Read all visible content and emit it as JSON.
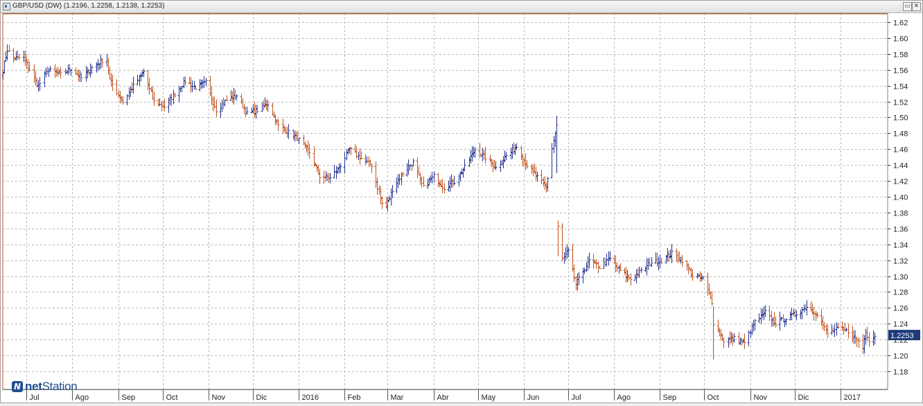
{
  "window": {
    "title": "GBP/USD (DW) (1.2196, 1.2258, 1.2138, 1.2253)",
    "minimize_glyph": "▭",
    "close_glyph": "✕"
  },
  "logo": {
    "prefix": "net",
    "suffix": "Station"
  },
  "chart_data": {
    "type": "ohlc",
    "title": "GBP/USD (DW) (1.2196, 1.2258, 1.2138, 1.2253)",
    "ylim": [
      1.16,
      1.63
    ],
    "y_ticks": [
      "1.18",
      "1.20",
      "1.22",
      "1.24",
      "1.26",
      "1.28",
      "1.30",
      "1.32",
      "1.34",
      "1.36",
      "1.38",
      "1.40",
      "1.42",
      "1.44",
      "1.46",
      "1.48",
      "1.50",
      "1.52",
      "1.54",
      "1.56",
      "1.58",
      "1.60",
      "1.62"
    ],
    "x_range": [
      "2015-06-15",
      "2017-01-31"
    ],
    "x_ticks": [
      {
        "label": "Jul",
        "date": "2015-07-01"
      },
      {
        "label": "Ago",
        "date": "2015-08-01"
      },
      {
        "label": "Sep",
        "date": "2015-09-01"
      },
      {
        "label": "Oct",
        "date": "2015-10-01"
      },
      {
        "label": "Nov",
        "date": "2015-11-01"
      },
      {
        "label": "Dic",
        "date": "2015-12-01"
      },
      {
        "label": "2016",
        "date": "2016-01-01"
      },
      {
        "label": "Feb",
        "date": "2016-02-01"
      },
      {
        "label": "Mar",
        "date": "2016-03-01"
      },
      {
        "label": "Abr",
        "date": "2016-04-01"
      },
      {
        "label": "May",
        "date": "2016-05-01"
      },
      {
        "label": "Jun",
        "date": "2016-06-01"
      },
      {
        "label": "Jul",
        "date": "2016-07-01"
      },
      {
        "label": "Ago",
        "date": "2016-08-01"
      },
      {
        "label": "Sep",
        "date": "2016-09-01"
      },
      {
        "label": "Oct",
        "date": "2016-10-01"
      },
      {
        "label": "Nov",
        "date": "2016-11-01"
      },
      {
        "label": "Dic",
        "date": "2016-12-01"
      },
      {
        "label": "2017",
        "date": "2017-01-01"
      }
    ],
    "current_price": "1.2253",
    "grid": true,
    "colors": {
      "up": "#1f2f8f",
      "down": "#c0501c",
      "grid": "#b8b8b8",
      "price_tag": "#1e3a78"
    },
    "close_anchors": [
      [
        "2015-06-15",
        1.56
      ],
      [
        "2015-06-18",
        1.585
      ],
      [
        "2015-06-22",
        1.575
      ],
      [
        "2015-06-29",
        1.575
      ],
      [
        "2015-07-06",
        1.55
      ],
      [
        "2015-07-09",
        1.54
      ],
      [
        "2015-07-15",
        1.56
      ],
      [
        "2015-07-24",
        1.555
      ],
      [
        "2015-07-31",
        1.562
      ],
      [
        "2015-08-07",
        1.55
      ],
      [
        "2015-08-14",
        1.563
      ],
      [
        "2015-08-21",
        1.572
      ],
      [
        "2015-08-24",
        1.573
      ],
      [
        "2015-08-26",
        1.548
      ],
      [
        "2015-09-04",
        1.52
      ],
      [
        "2015-09-11",
        1.54
      ],
      [
        "2015-09-18",
        1.558
      ],
      [
        "2015-09-25",
        1.52
      ],
      [
        "2015-10-02",
        1.514
      ],
      [
        "2015-10-09",
        1.53
      ],
      [
        "2015-10-16",
        1.546
      ],
      [
        "2015-10-23",
        1.538
      ],
      [
        "2015-10-30",
        1.544
      ],
      [
        "2015-11-06",
        1.51
      ],
      [
        "2015-11-13",
        1.522
      ],
      [
        "2015-11-20",
        1.528
      ],
      [
        "2015-11-27",
        1.505
      ],
      [
        "2015-12-04",
        1.51
      ],
      [
        "2015-12-11",
        1.518
      ],
      [
        "2015-12-18",
        1.49
      ],
      [
        "2015-12-31",
        1.474
      ],
      [
        "2016-01-08",
        1.456
      ],
      [
        "2016-01-15",
        1.426
      ],
      [
        "2016-01-22",
        1.424
      ],
      [
        "2016-01-29",
        1.44
      ],
      [
        "2016-02-04",
        1.46
      ],
      [
        "2016-02-12",
        1.449
      ],
      [
        "2016-02-19",
        1.44
      ],
      [
        "2016-02-26",
        1.392
      ],
      [
        "2016-02-29",
        1.388
      ],
      [
        "2016-03-04",
        1.41
      ],
      [
        "2016-03-11",
        1.43
      ],
      [
        "2016-03-18",
        1.444
      ],
      [
        "2016-03-25",
        1.412
      ],
      [
        "2016-04-01",
        1.426
      ],
      [
        "2016-04-08",
        1.412
      ],
      [
        "2016-04-15",
        1.42
      ],
      [
        "2016-04-22",
        1.437
      ],
      [
        "2016-04-29",
        1.46
      ],
      [
        "2016-05-06",
        1.45
      ],
      [
        "2016-05-13",
        1.437
      ],
      [
        "2016-05-20",
        1.452
      ],
      [
        "2016-05-27",
        1.464
      ],
      [
        "2016-06-03",
        1.44
      ],
      [
        "2016-06-10",
        1.425
      ],
      [
        "2016-06-16",
        1.412
      ],
      [
        "2016-06-20",
        1.462
      ],
      [
        "2016-06-23",
        1.49
      ],
      [
        "2016-06-24",
        1.362
      ],
      [
        "2016-06-27",
        1.322
      ],
      [
        "2016-07-01",
        1.332
      ],
      [
        "2016-07-06",
        1.29
      ],
      [
        "2016-07-15",
        1.32
      ],
      [
        "2016-07-22",
        1.312
      ],
      [
        "2016-07-29",
        1.322
      ],
      [
        "2016-08-05",
        1.307
      ],
      [
        "2016-08-12",
        1.297
      ],
      [
        "2016-08-19",
        1.306
      ],
      [
        "2016-08-26",
        1.318
      ],
      [
        "2016-09-02",
        1.32
      ],
      [
        "2016-09-09",
        1.329
      ],
      [
        "2016-09-16",
        1.321
      ],
      [
        "2016-09-23",
        1.301
      ],
      [
        "2016-09-30",
        1.297
      ],
      [
        "2016-10-06",
        1.268
      ],
      [
        "2016-10-07",
        1.241
      ],
      [
        "2016-10-14",
        1.219
      ],
      [
        "2016-10-21",
        1.222
      ],
      [
        "2016-10-28",
        1.216
      ],
      [
        "2016-11-04",
        1.243
      ],
      [
        "2016-11-11",
        1.254
      ],
      [
        "2016-11-18",
        1.241
      ],
      [
        "2016-11-25",
        1.247
      ],
      [
        "2016-12-02",
        1.253
      ],
      [
        "2016-12-09",
        1.262
      ],
      [
        "2016-12-16",
        1.253
      ],
      [
        "2016-12-23",
        1.228
      ],
      [
        "2016-12-30",
        1.234
      ],
      [
        "2017-01-06",
        1.231
      ],
      [
        "2017-01-13",
        1.218
      ],
      [
        "2017-01-16",
        1.21
      ],
      [
        "2017-01-18",
        1.232
      ],
      [
        "2017-01-20",
        1.22
      ],
      [
        "2017-01-24",
        1.2253
      ]
    ]
  }
}
